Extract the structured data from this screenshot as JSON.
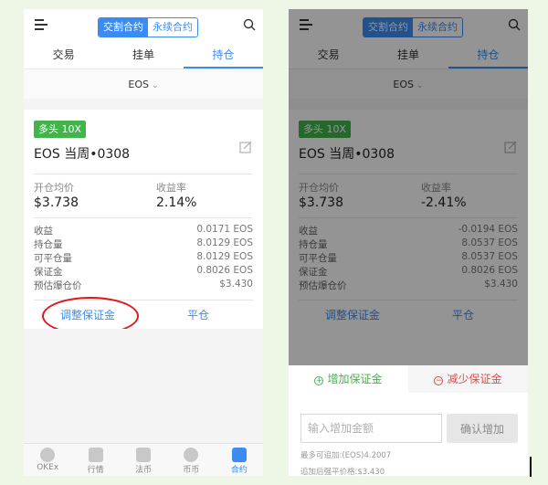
{
  "header": {
    "segment_active": "交割合约",
    "segment_inactive": "永续合约"
  },
  "tabs": [
    "交易",
    "挂单",
    "持仓"
  ],
  "symbol": "EOS",
  "position": {
    "badge": "多头 10X",
    "title": "EOS 当周•0308",
    "open_price_label": "开仓均价",
    "return_label": "收益率",
    "details_labels": [
      "收益",
      "持仓量",
      "可平仓量",
      "保证金",
      "预估爆仓价"
    ],
    "adjust_margin": "调整保证金",
    "close": "平仓"
  },
  "left": {
    "open_price": "$3.738",
    "return_rate": "2.14%",
    "details_values": [
      "0.0171 EOS",
      "8.0129 EOS",
      "8.0129 EOS",
      "0.8026 EOS",
      "$3.430"
    ]
  },
  "right": {
    "open_price": "$3.738",
    "return_rate": "-2.41%",
    "details_values": [
      "-0.0194 EOS",
      "8.0537 EOS",
      "8.0537 EOS",
      "0.8026 EOS",
      "$3.430"
    ]
  },
  "bottom_nav": [
    "OKEx",
    "行情",
    "法币",
    "币币",
    "合约"
  ],
  "margin_panel": {
    "add_tab": "增加保证金",
    "reduce_tab": "减少保证金",
    "input_placeholder": "输入增加金额",
    "confirm_button": "确认增加",
    "max_note": "最多可追加:(EOS)4.2007",
    "liq_note": "追加后强平价格:$3.430"
  },
  "colors": {
    "accent": "#3b8cf2",
    "long_badge": "#43b34c",
    "highlight_ring": "#e0161d",
    "reduce": "#e04b4b"
  }
}
